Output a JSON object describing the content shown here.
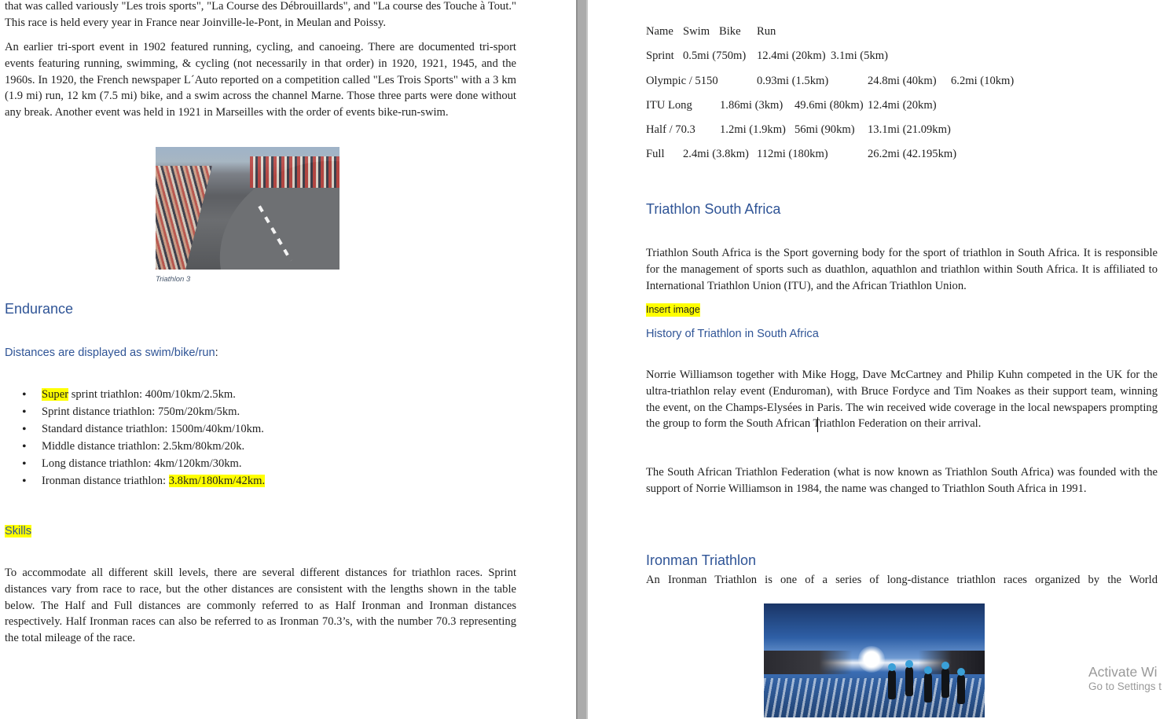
{
  "left_page": {
    "intro_para": "that was called variously \"Les trois sports\", \"La Course des Débrouillards\", and \"La course des Touche à Tout.\" This race is held every year in France near Joinville-le-Pont, in Meulan and Poissy.",
    "history_para": "An earlier tri-sport event in 1902 featured running, cycling, and canoeing. There are documented tri-sport events featuring running, swimming, & cycling (not necessarily in that order) in 1920, 1921, 1945, and the 1960s. In 1920, the French newspaper L´Auto reported on a competition called \"Les Trois Sports\" with a 3 km (1.9 mi) run, 12 km (7.5 mi) bike, and a swim across the channel Marne. Those three parts were done without any break. Another event was held in 1921 in Marseilles with the order of events bike-run-swim.",
    "figure_caption": "Triathlon 3",
    "endurance_heading": "Endurance",
    "distances_subheading": "Distances are displayed as swim/bike/run",
    "distances_colon": ":",
    "distance_items": [
      {
        "prefix": "",
        "highlight": "Super",
        "suffix": " sprint triathlon: 400m/10km/2.5km."
      },
      {
        "prefix": "Sprint distance triathlon: 750m/20km/5km.",
        "highlight": "",
        "suffix": ""
      },
      {
        "prefix": "Standard distance triathlon: 1500m/40km/10km.",
        "highlight": "",
        "suffix": ""
      },
      {
        "prefix": "Middle distance triathlon: 2.5km/80km/20k.",
        "highlight": "",
        "suffix": ""
      },
      {
        "prefix": "Long distance triathlon: 4km/120km/30km.",
        "highlight": "",
        "suffix": ""
      },
      {
        "prefix": "Ironman distance triathlon: ",
        "highlight": "3.8km/180km/42km.",
        "suffix": ""
      }
    ],
    "skills_heading": "Skills",
    "skills_para": "To accommodate all different skill levels, there are several different distances for triathlon races. Sprint distances vary from race to race, but the other distances are consistent with the lengths shown in the table below. The Half and Full distances are commonly referred to as Half Ironman and Ironman distances respectively. Half Ironman races can also be referred to as Ironman 70.3’s, with the number 70.3 representing the total mileage of the race."
  },
  "right_page": {
    "table": {
      "rows": [
        {
          "name": "Name",
          "swim": "Swim",
          "bike": "Bike",
          "run": "Run"
        },
        {
          "name": "Sprint",
          "swim": "0.5mi (750m)",
          "bike": "12.4mi (20km)",
          "run": "3.1mi (5km)"
        },
        {
          "name": "Olympic / 5150",
          "swim": "0.93mi (1.5km)",
          "bike": "24.8mi (40km)",
          "run": "6.2mi (10km)"
        },
        {
          "name": "ITU Long",
          "swim": "1.86mi (3km)",
          "bike": "49.6mi (80km)",
          "run": "12.4mi (20km)"
        },
        {
          "name": "Half / 70.3",
          "swim": "1.2mi (1.9km)",
          "bike": "56mi (90km)",
          "run": "13.1mi (21.09km)"
        },
        {
          "name": "Full",
          "swim": "2.4mi (3.8km)",
          "bike": "112mi (180km)",
          "run": "26.2mi (42.195km)"
        }
      ]
    },
    "tsa_heading": "Triathlon South Africa",
    "tsa_para": "Triathlon South Africa is the Sport governing body for the sport of triathlon in South Africa. It is responsible for the management of sports such as duathlon, aquathlon and triathlon within South Africa. It is affiliated to International Triathlon Union (ITU), and the African Triathlon Union.",
    "insert_image_note": "Insert image",
    "history_heading": "History of Triathlon in South Africa",
    "norrie_para": "Norrie Williamson together with Mike Hogg, Dave McCartney and Philip Kuhn competed in the UK for the ultra-triathlon relay event (Enduroman), with Bruce Fordyce and Tim Noakes as their support team, winning the event, on the Champs-Elysées in Paris. The win received wide coverage in the local newspapers prompting the group to form the South African Triathlon Federation on their arrival.",
    "federation_para": "The South African Triathlon Federation (what is now known as Triathlon South Africa) was founded with the support of Norrie Williamson in 1984, the name was changed to Triathlon South Africa in 1991.",
    "ironman_heading": "Ironman Triathlon",
    "ironman_para": "An Ironman Triathlon is one of a series of long-distance triathlon races organized by the World"
  },
  "watermark": {
    "line1": "Activate Wi",
    "line2": "Go to Settings t"
  },
  "colors": {
    "heading_blue": "#2f5496",
    "highlight_yellow": "#ffff00",
    "gutter_gray": "#ababab"
  }
}
